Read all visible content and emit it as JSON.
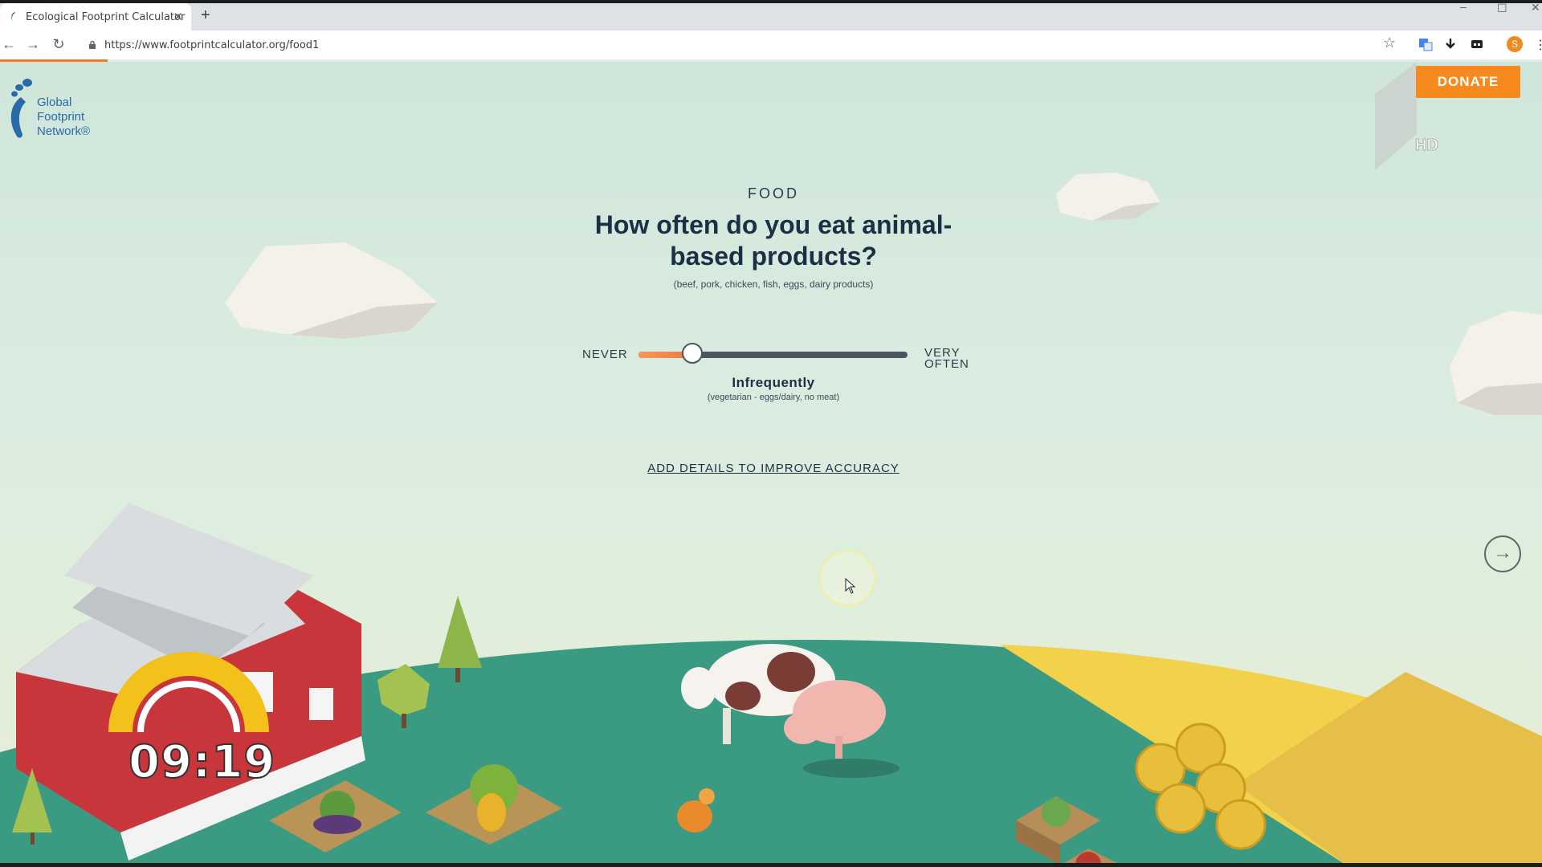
{
  "browser": {
    "tab_title": "Ecological Footprint Calculator",
    "tab_close": "✕",
    "new_tab": "+",
    "url": "https://www.footprintcalculator.org/food1",
    "nav": {
      "back": "←",
      "forward": "→",
      "reload": "↻"
    },
    "star": "☆",
    "profile_initial": "S",
    "menu": "⋮",
    "page_load_progress": 0.07
  },
  "logo": {
    "line1": "Global",
    "line2": "Footprint",
    "line3": "Network®"
  },
  "donate_label": "DONATE",
  "hd_label": "HD",
  "question": {
    "category": "FOOD",
    "title": "How often do you eat animal-based products?",
    "subtitle": "(beef, pork, chicken, fish, eggs, dairy products)"
  },
  "slider": {
    "min_label": "NEVER",
    "max_label": "VERY OFTEN",
    "level": 0.2,
    "value_label": "Infrequently",
    "value_description": "(vegetarian - eggs/dairy, no meat)"
  },
  "details_link": "ADD DETAILS TO IMPROVE ACCURACY",
  "next_arrow": "→",
  "overlay_timer": "09:19",
  "colors": {
    "accent_orange": "#f68a1f",
    "heading_navy": "#1d2f45",
    "hill_green": "#3a9a82",
    "field_yellow": "#f2d24a"
  }
}
